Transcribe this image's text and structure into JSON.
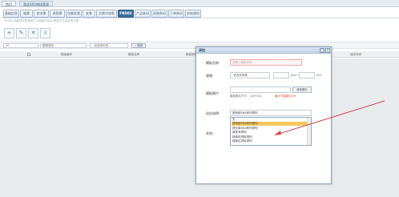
{
  "top_tabs": [
    "首页",
    "我这SKU审核管理"
  ],
  "nav_tabs": [
    "基础信息",
    "操票",
    "首次票",
    "采购票",
    "包裹发票",
    "发票",
    "货票代收款",
    "FNSKU",
    "产品条码",
    "采购条码",
    "下单条码",
    "系统通用"
  ],
  "active_nav_index": 7,
  "tip_text": "FNSKU可维护在售商品行以商品FNSKU添加方式设定的记录",
  "toolbar_icons": [
    "add-icon",
    "edit-icon",
    "delete-icon",
    "export-icon"
  ],
  "filter": {
    "page_size": "30",
    "search_placeholder": "模糊搜索",
    "select_label": "--请选择标签--",
    "search_label": "搜索"
  },
  "table_headers": [
    "模板编号",
    "模板名称",
    "模板规格",
    "适应时间"
  ],
  "modal": {
    "title": "添加",
    "name_label": "模板名称:",
    "name_placeholder": "请输入模板名称",
    "spec_label": "规格:",
    "spec_placeholder": "-请选择规格-",
    "unit_mm_1": "mm *",
    "unit_mm_2": "mm",
    "image_label": "模板图片:",
    "upload_label": "选择图片",
    "image_size_note": "模板图片尺寸：140*140",
    "image_limit_note": "最大不能超过2M",
    "apply_label": "适应选择:",
    "apply_value": "按系统SKU序列排列",
    "status_label": "状态:",
    "dropdown_options": [
      "无",
      "按系统SKU序列排列",
      "按仓库SKU序列排列",
      "按序号排列",
      "按库存排序排列",
      "按库位排序排列"
    ],
    "selected_option_index": 1
  },
  "colors": {
    "nav_active": "#3e6f9e",
    "highlight": "#f6c85f",
    "warning": "#e04a2a",
    "arrow": "#d0464a"
  }
}
